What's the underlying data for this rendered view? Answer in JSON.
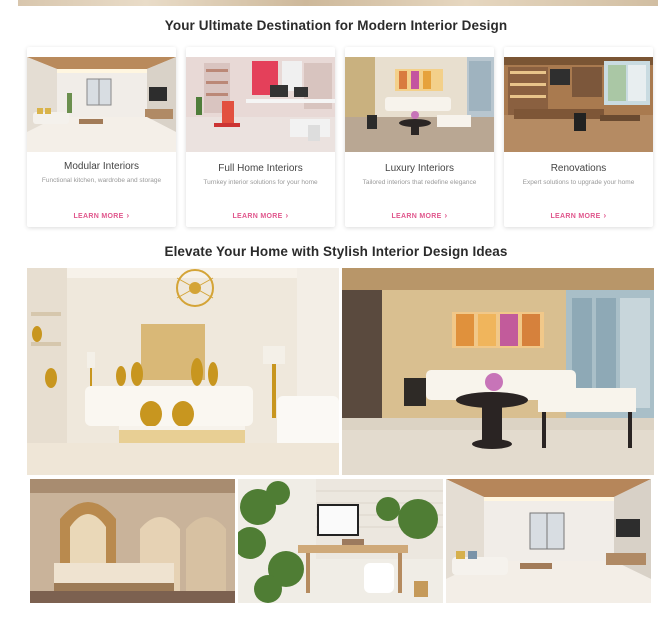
{
  "sections": {
    "services_title": "Your Ultimate Destination for Modern Interior Design",
    "gallery_title": "Elevate Your Home with Stylish Interior Design Ideas"
  },
  "cards": [
    {
      "title": "Modular Interiors",
      "description": "Functional kitchen, wardrobe and storage",
      "link": "LEARN MORE",
      "chevron": "›"
    },
    {
      "title": "Full Home Interiors",
      "description": "Turnkey interior solutions for your home",
      "link": "LEARN MORE",
      "chevron": "›"
    },
    {
      "title": "Luxury Interiors",
      "description": "Tailored interiors that redefine elegance",
      "link": "LEARN MORE",
      "chevron": "›"
    },
    {
      "title": "Renovations",
      "description": "Expert solutions to upgrade your home",
      "link": "LEARN MORE",
      "chevron": "›"
    }
  ],
  "colors": {
    "accent": "#e0568c",
    "heading": "#2b2b2b",
    "muted": "#9a9a9a"
  }
}
